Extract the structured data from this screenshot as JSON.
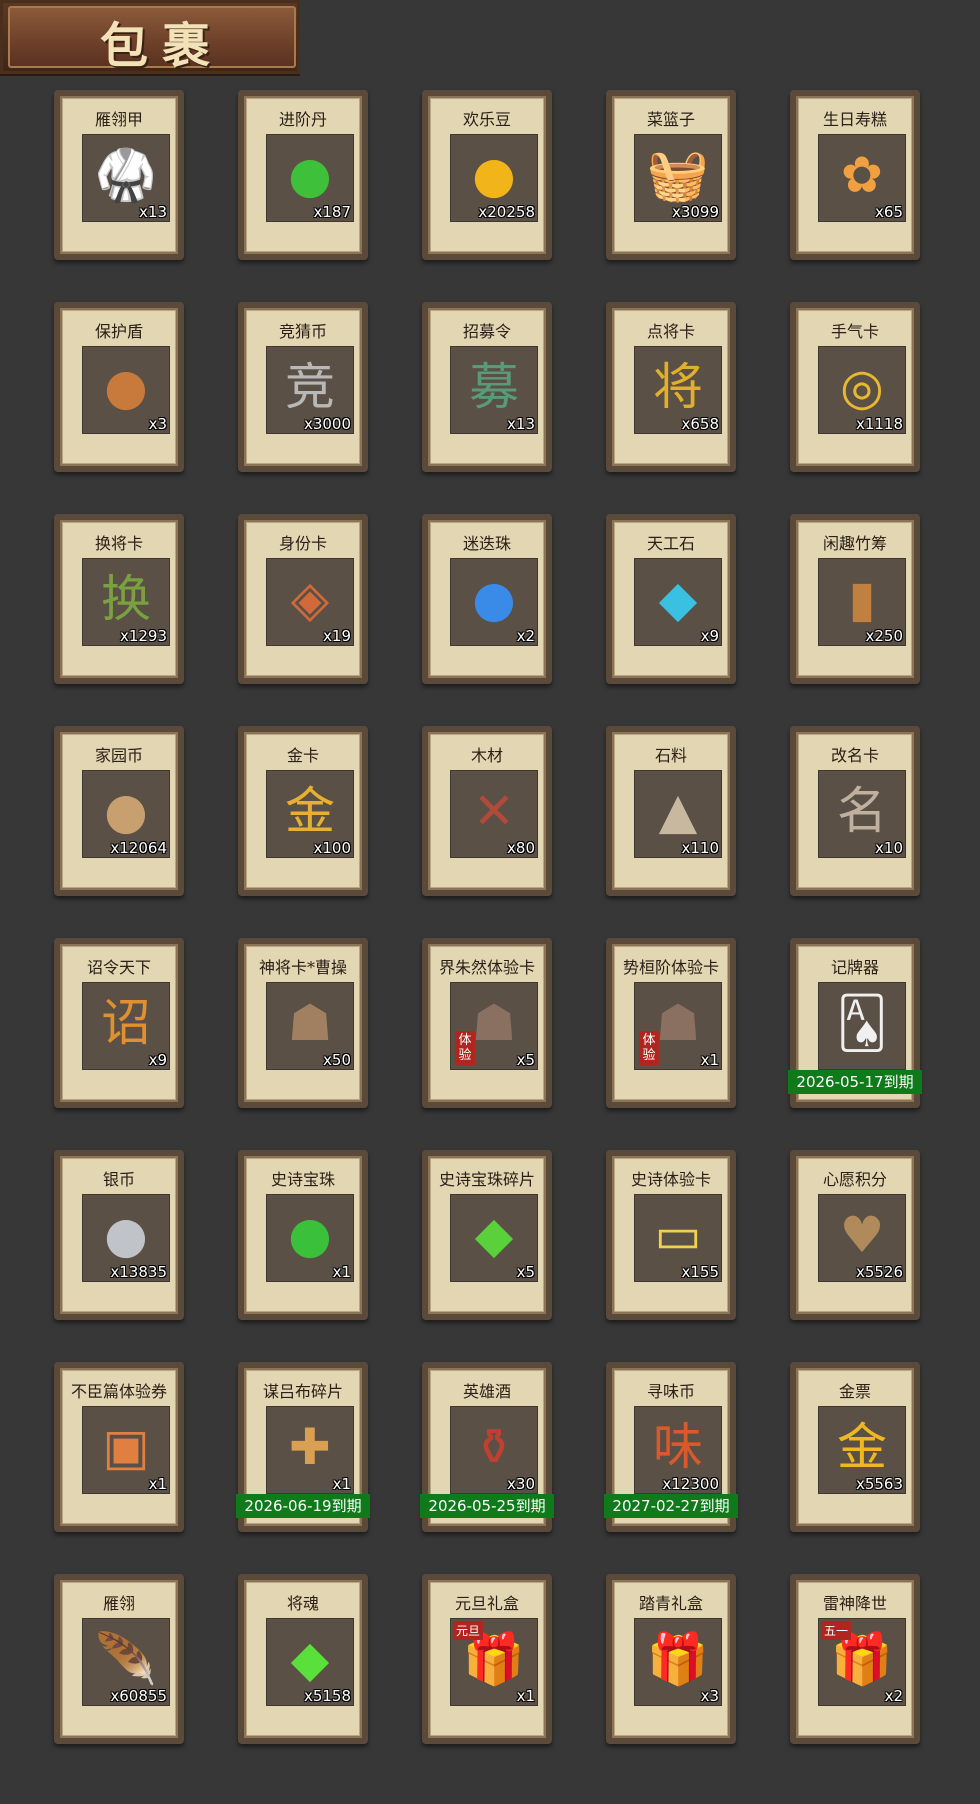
{
  "header": {
    "title": "包裹"
  },
  "items": [
    {
      "name": "雁翎甲",
      "qty": "x13",
      "icon": "armor-icon",
      "glyph": "🥋",
      "color": "#c23a2a"
    },
    {
      "name": "进阶丹",
      "qty": "x187",
      "icon": "green-pill-icon",
      "glyph": "●",
      "color": "#3fc03a"
    },
    {
      "name": "欢乐豆",
      "qty": "x20258",
      "icon": "gold-beans-icon",
      "glyph": "●",
      "color": "#f1b51a"
    },
    {
      "name": "菜篮子",
      "qty": "x3099",
      "icon": "basket-icon",
      "glyph": "🧺",
      "color": "#c89a3a"
    },
    {
      "name": "生日寿糕",
      "qty": "x65",
      "icon": "cake-icon",
      "glyph": "✿",
      "color": "#f0a040"
    },
    {
      "name": "保护盾",
      "qty": "x3",
      "icon": "shield-icon",
      "glyph": "●",
      "color": "#c77a3c"
    },
    {
      "name": "竞猜币",
      "qty": "x3000",
      "icon": "silver-coin-icon",
      "glyph": "竞",
      "color": "#b8b8b8"
    },
    {
      "name": "招募令",
      "qty": "x13",
      "icon": "recruit-token-icon",
      "glyph": "募",
      "color": "#5a9a7a"
    },
    {
      "name": "点将卡",
      "qty": "x658",
      "icon": "general-card-icon",
      "glyph": "将",
      "color": "#e0b02a"
    },
    {
      "name": "手气卡",
      "qty": "x1118",
      "icon": "luck-card-icon",
      "glyph": "◎",
      "color": "#e8b830"
    },
    {
      "name": "换将卡",
      "qty": "x1293",
      "icon": "swap-card-icon",
      "glyph": "换",
      "color": "#7aa040"
    },
    {
      "name": "身份卡",
      "qty": "x19",
      "icon": "identity-card-icon",
      "glyph": "◈",
      "color": "#d06a3a"
    },
    {
      "name": "迷迭珠",
      "qty": "x2",
      "icon": "blue-orb-icon",
      "glyph": "●",
      "color": "#3a8ae8"
    },
    {
      "name": "天工石",
      "qty": "x9",
      "icon": "crystal-icon",
      "glyph": "◆",
      "color": "#3ac0e0"
    },
    {
      "name": "闲趣竹筹",
      "qty": "x250",
      "icon": "bamboo-token-icon",
      "glyph": "▮",
      "color": "#c08040"
    },
    {
      "name": "家园币",
      "qty": "x12064",
      "icon": "home-coin-icon",
      "glyph": "●",
      "color": "#c8a070"
    },
    {
      "name": "金卡",
      "qty": "x100",
      "icon": "gold-card-icon",
      "glyph": "金",
      "color": "#e8b030"
    },
    {
      "name": "木材",
      "qty": "x80",
      "icon": "wood-icon",
      "glyph": "✕",
      "color": "#b04a3a"
    },
    {
      "name": "石料",
      "qty": "x110",
      "icon": "stone-icon",
      "glyph": "▲",
      "color": "#c8b8a0"
    },
    {
      "name": "改名卡",
      "qty": "x10",
      "icon": "rename-card-icon",
      "glyph": "名",
      "color": "#c0b0a0"
    },
    {
      "name": "诏令天下",
      "qty": "x9",
      "icon": "decree-scroll-icon",
      "glyph": "诏",
      "color": "#e09030"
    },
    {
      "name": "神将卡*曹操",
      "qty": "x50",
      "icon": "hero-portrait-icon",
      "glyph": "☗",
      "color": "#a08060"
    },
    {
      "name": "界朱然体验卡",
      "qty": "x5",
      "icon": "trial-hero-icon",
      "glyph": "☗",
      "color": "#8a7060",
      "badge": "体验"
    },
    {
      "name": "势桓阶体验卡",
      "qty": "x1",
      "icon": "trial-hero-icon",
      "glyph": "☗",
      "color": "#8a7060",
      "badge": "体验"
    },
    {
      "name": "记牌器",
      "qty": "",
      "icon": "playing-cards-icon",
      "glyph": "🂡",
      "color": "#f0f0f0",
      "expiry": "2026-05-17到期"
    },
    {
      "name": "银币",
      "qty": "x13835",
      "icon": "silver-coins-icon",
      "glyph": "●",
      "color": "#c0c4c8"
    },
    {
      "name": "史诗宝珠",
      "qty": "x1",
      "icon": "green-orb-icon",
      "glyph": "●",
      "color": "#3ac03a"
    },
    {
      "name": "史诗宝珠碎片",
      "qty": "x5",
      "icon": "green-shard-icon",
      "glyph": "◆",
      "color": "#5ad03a"
    },
    {
      "name": "史诗体验卡",
      "qty": "x155",
      "icon": "epic-card-icon",
      "glyph": "▭",
      "color": "#f0d050"
    },
    {
      "name": "心愿积分",
      "qty": "x5526",
      "icon": "heart-coin-icon",
      "glyph": "♥",
      "color": "#b08a5a"
    },
    {
      "name": "不臣篇体验券",
      "qty": "x1",
      "icon": "voucher-icon",
      "glyph": "▣",
      "color": "#e08040"
    },
    {
      "name": "谋吕布碎片",
      "qty": "x1",
      "icon": "puzzle-piece-icon",
      "glyph": "✚",
      "color": "#d8a050",
      "expiry": "2026-06-19到期"
    },
    {
      "name": "英雄酒",
      "qty": "x30",
      "icon": "wine-jar-icon",
      "glyph": "⚱",
      "color": "#c04030",
      "expiry": "2026-05-25到期"
    },
    {
      "name": "寻味币",
      "qty": "x12300",
      "icon": "flavor-coin-icon",
      "glyph": "味",
      "color": "#d85a2a",
      "expiry": "2027-02-27到期"
    },
    {
      "name": "金票",
      "qty": "x5563",
      "icon": "gold-ticket-icon",
      "glyph": "金",
      "color": "#f0b820"
    },
    {
      "name": "雁翎",
      "qty": "x60855",
      "icon": "feather-icon",
      "glyph": "🪶",
      "color": "#e8c890"
    },
    {
      "name": "将魂",
      "qty": "x5158",
      "icon": "soul-crystal-icon",
      "glyph": "◆",
      "color": "#5ae03a"
    },
    {
      "name": "元旦礼盒",
      "qty": "x1",
      "icon": "gift-box-icon",
      "glyph": "🎁",
      "color": "#3a7ad0",
      "tag": "元旦"
    },
    {
      "name": "踏青礼盒",
      "qty": "x3",
      "icon": "gift-box-icon",
      "glyph": "🎁",
      "color": "#2a9a4a"
    },
    {
      "name": "雷神降世",
      "qty": "x2",
      "icon": "gift-box-icon",
      "glyph": "🎁",
      "color": "#e0b840",
      "tag": "五一"
    }
  ]
}
